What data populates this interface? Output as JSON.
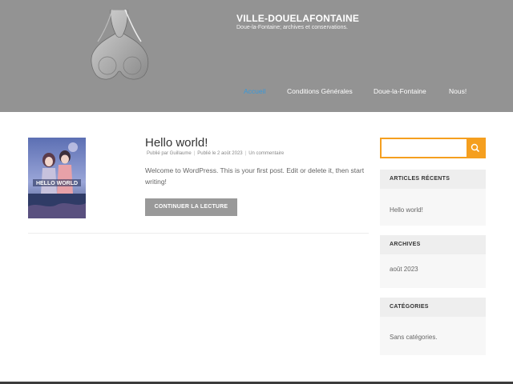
{
  "site": {
    "title": "VILLE-DOUELAFONTAINE",
    "description": "Doue-la-Fontaine; archives et conservations."
  },
  "nav": {
    "items": [
      {
        "label": "Accueil"
      },
      {
        "label": "Conditions Générales"
      },
      {
        "label": "Doue-la-Fontaine"
      },
      {
        "label": "Nous!"
      }
    ]
  },
  "post": {
    "title": "Hello world!",
    "meta": {
      "author": "Publié par Guillaume",
      "date": "Publié le 2 août 2023",
      "comments": "Un commentaire"
    },
    "excerpt": "Welcome to WordPress. This is your first post. Edit or delete it, then start writing!",
    "read_more": "CONTINUER LA LECTURE",
    "thumbnail_text": "HELLO WORLD"
  },
  "search": {
    "placeholder": ""
  },
  "sidebar": {
    "recent": {
      "heading": "ARTICLES RÉCENTS",
      "item": "Hello world!"
    },
    "archives": {
      "heading": "ARCHIVES",
      "item": "août 2023"
    },
    "categories": {
      "heading": "CATÉGORIES",
      "item": "Sans catégories."
    }
  },
  "colors": {
    "header_bg": "#939393",
    "accent": "#f59f1f",
    "active_nav": "#3a98d8",
    "button_bg": "#999999"
  }
}
